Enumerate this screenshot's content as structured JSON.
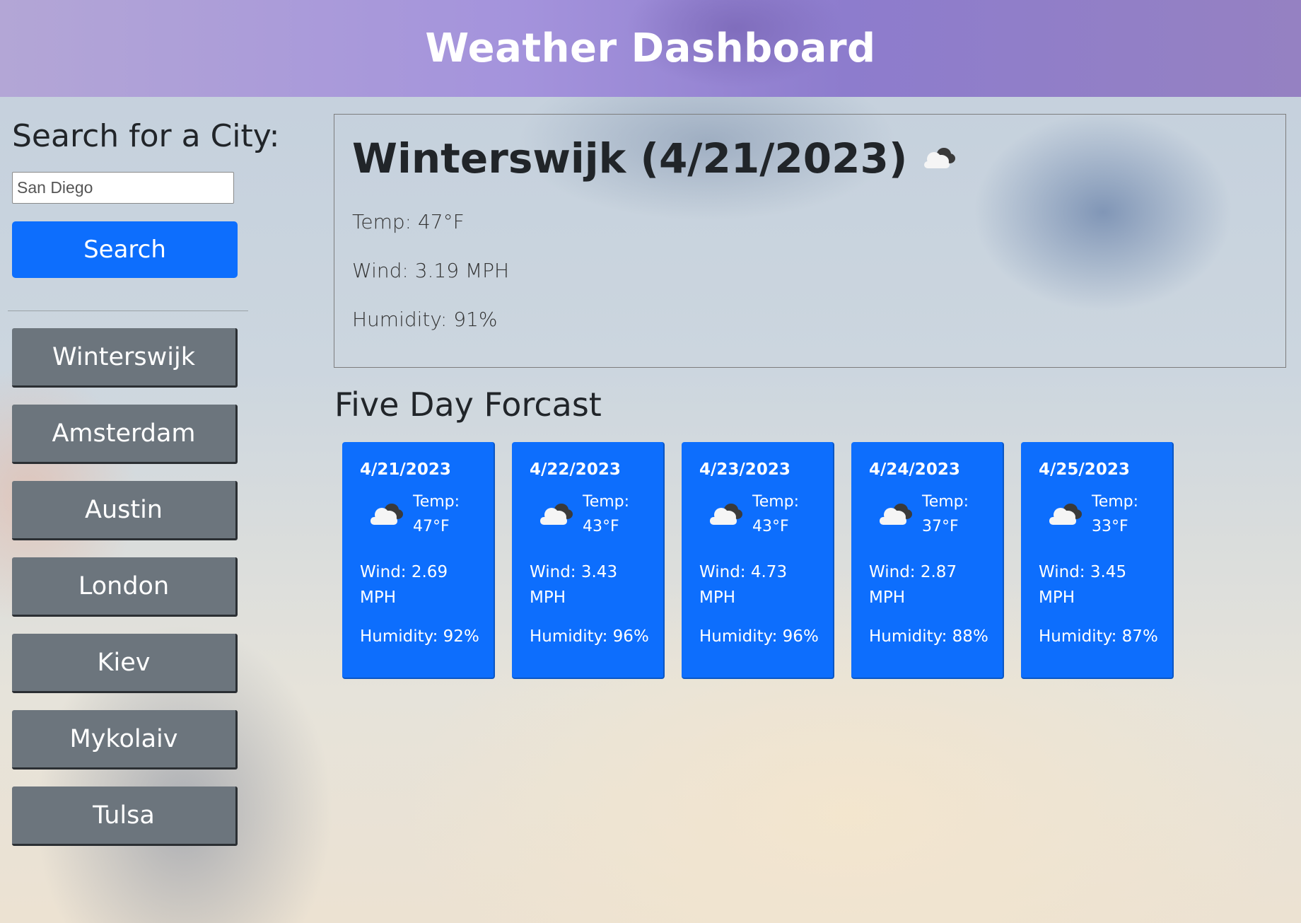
{
  "header": {
    "title": "Weather Dashboard"
  },
  "search": {
    "heading": "Search for a City:",
    "input_value": "San Diego",
    "button_label": "Search"
  },
  "history": [
    {
      "label": "Winterswijk"
    },
    {
      "label": "Amsterdam"
    },
    {
      "label": "Austin"
    },
    {
      "label": "London"
    },
    {
      "label": "Kiev"
    },
    {
      "label": "Mykolaiv"
    },
    {
      "label": "Tulsa"
    }
  ],
  "current": {
    "title": "Winterswijk (4/21/2023)",
    "icon": "cloud-icon",
    "temp": "Temp: 47°F",
    "wind": "Wind: 3.19 MPH",
    "humidity": "Humidity: 91%"
  },
  "forecast": {
    "heading": "Five Day Forcast",
    "days": [
      {
        "date": "4/21/2023",
        "icon": "partly-cloudy-icon",
        "temp_label": "Temp:",
        "temp": "47°F",
        "wind": "Wind: 2.69 MPH",
        "humidity": "Humidity: 92%"
      },
      {
        "date": "4/22/2023",
        "icon": "partly-cloudy-icon",
        "temp_label": "Temp:",
        "temp": "43°F",
        "wind": "Wind: 3.43 MPH",
        "humidity": "Humidity: 96%"
      },
      {
        "date": "4/23/2023",
        "icon": "partly-cloudy-icon",
        "temp_label": "Temp:",
        "temp": "43°F",
        "wind": "Wind: 4.73 MPH",
        "humidity": "Humidity: 96%"
      },
      {
        "date": "4/24/2023",
        "icon": "partly-cloudy-icon",
        "temp_label": "Temp:",
        "temp": "37°F",
        "wind": "Wind: 2.87 MPH",
        "humidity": "Humidity: 88%"
      },
      {
        "date": "4/25/2023",
        "icon": "partly-cloudy-icon",
        "temp_label": "Temp:",
        "temp": "33°F",
        "wind": "Wind: 3.45 MPH",
        "humidity": "Humidity: 87%"
      }
    ]
  },
  "colors": {
    "primary": "#0d6efd",
    "secondary": "#6c757d",
    "header": "#a493dc"
  }
}
